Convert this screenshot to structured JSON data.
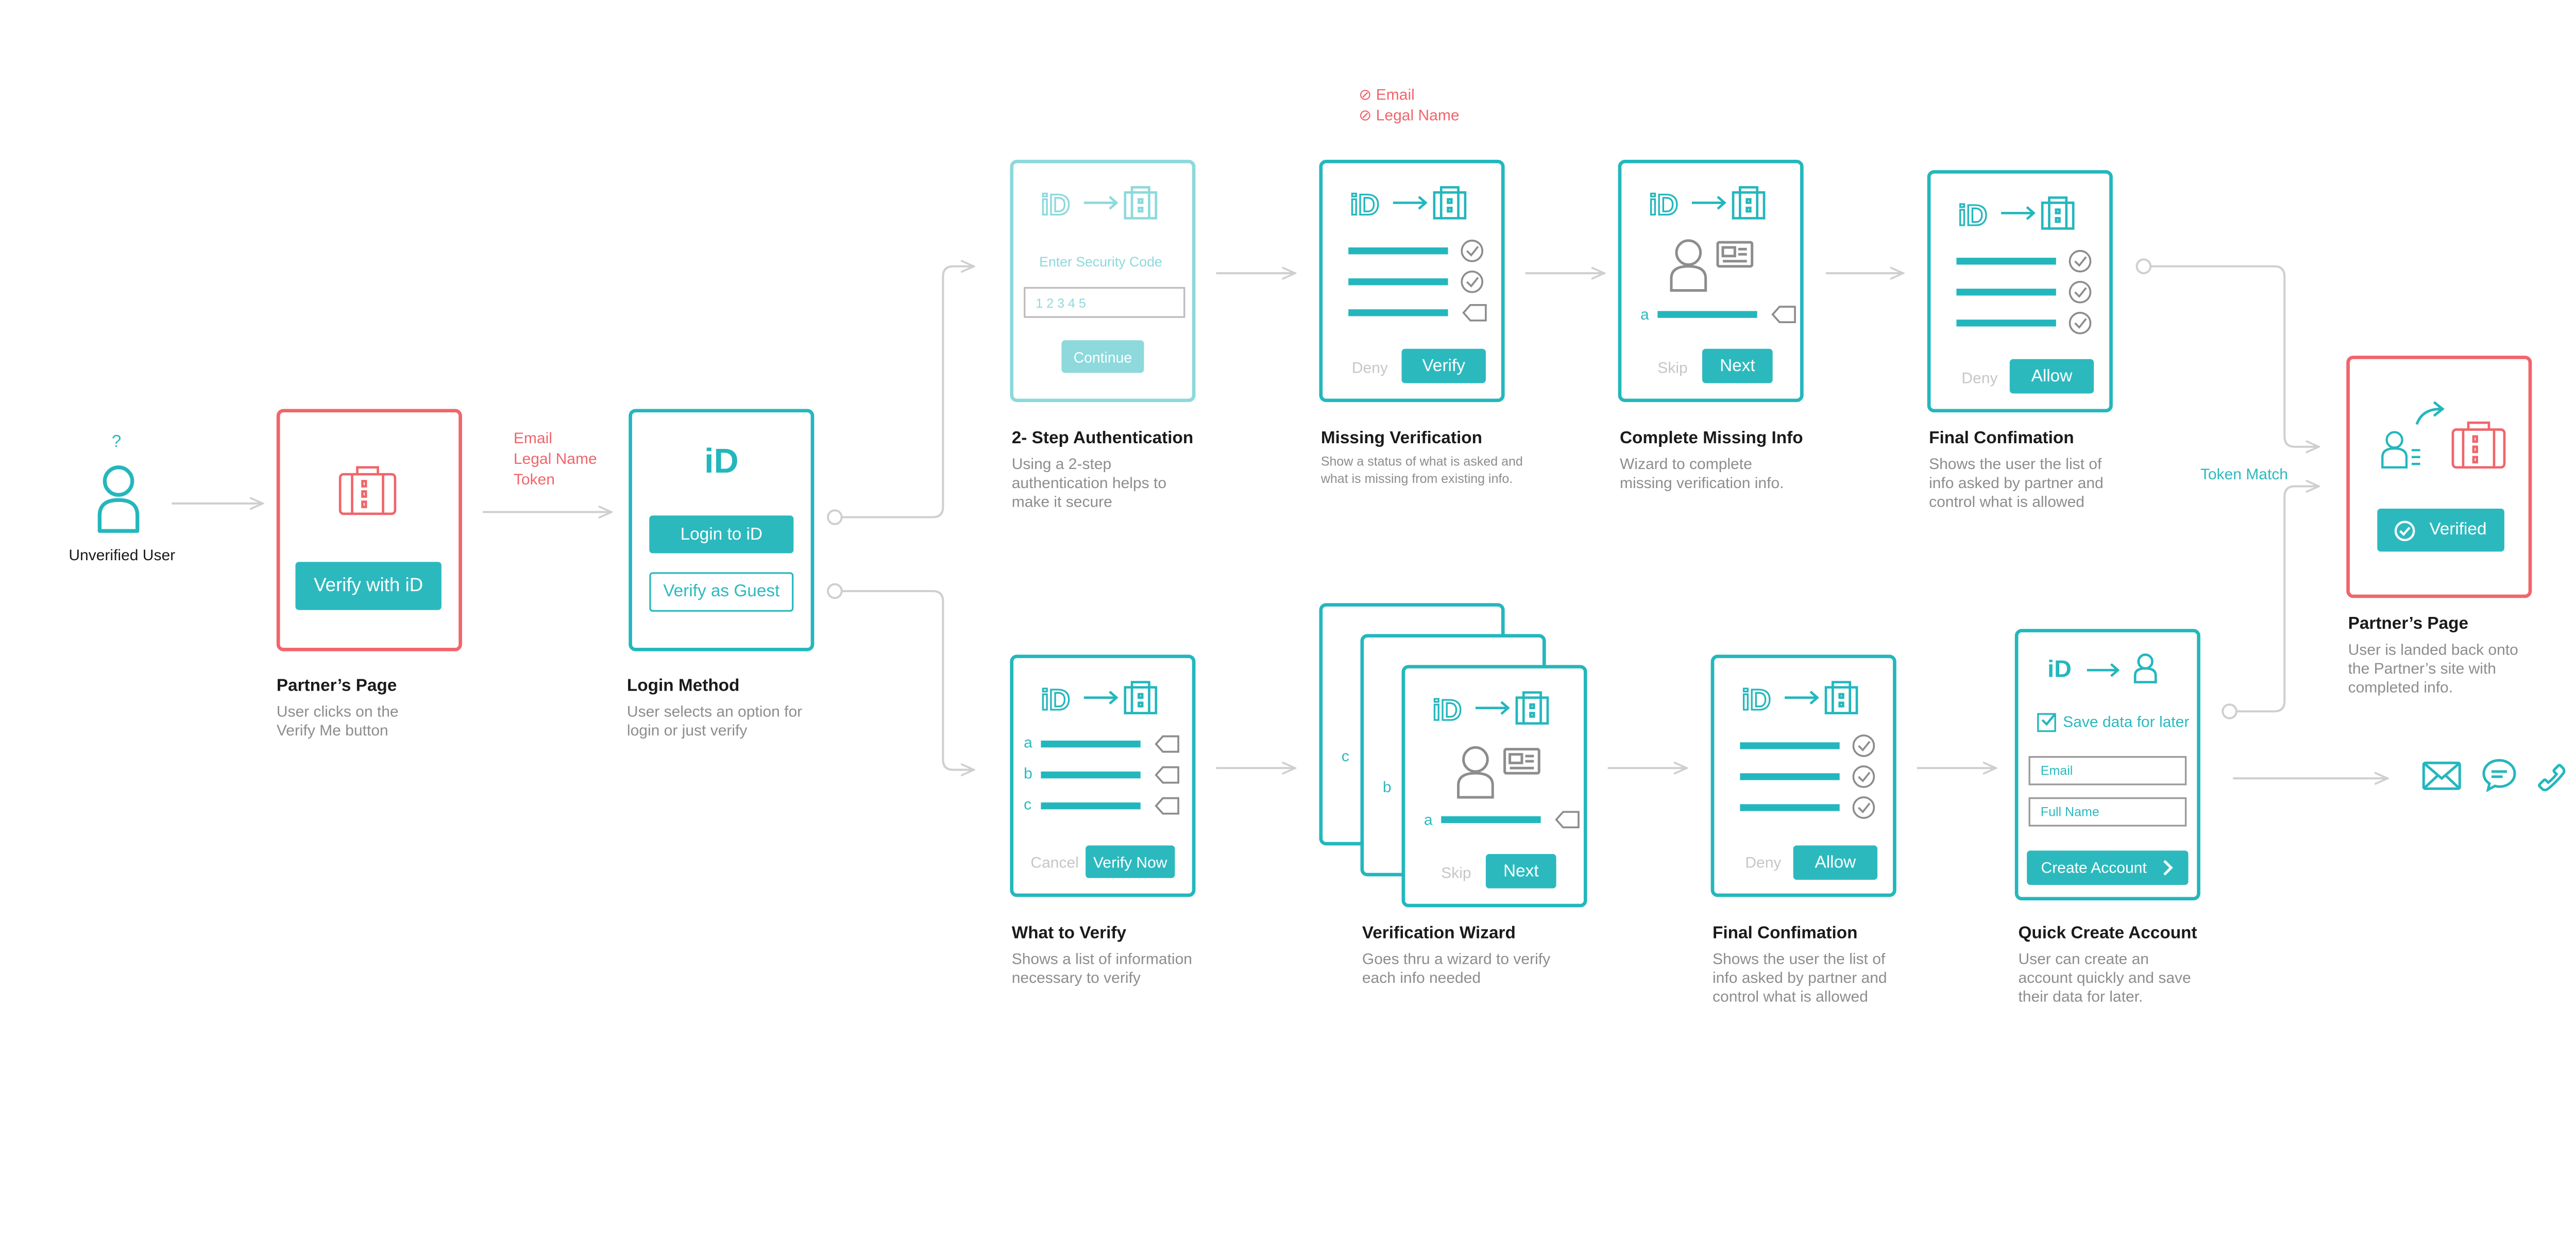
{
  "colors": {
    "teal": "#23b7bd",
    "red": "#f0656b",
    "line": "#cfcfcf",
    "gray": "#8d8d8d"
  },
  "start": {
    "question_mark": "?",
    "label": "Unverified User"
  },
  "partner_page": {
    "button": "Verify with iD",
    "title": "Partner’s Page",
    "desc": [
      "User clicks on the",
      "Verify Me button"
    ],
    "data_fields": [
      "Email",
      "Legal Name",
      "Token"
    ]
  },
  "login_method": {
    "login_button": "Login to iD",
    "guest_button": "Verify as Guest",
    "title": "Login Method",
    "desc": [
      "User selects an option for",
      "login or just verify"
    ]
  },
  "two_step": {
    "prompt": "Enter Security Code",
    "code": "1 2 3 4 5",
    "continue": "Continue",
    "title": "2- Step Authentication",
    "desc": [
      "Using a 2-step",
      "authentication helps to",
      "make it secure"
    ]
  },
  "missing_verification": {
    "notes": [
      "Email",
      "Legal Name"
    ],
    "deny": "Deny",
    "verify": "Verify",
    "title": "Missing Verification",
    "desc": [
      "Show a status of what is asked and",
      "what is missing from existing info."
    ]
  },
  "complete_missing": {
    "field_letter": "a",
    "skip": "Skip",
    "next": "Next",
    "title": "Complete Missing Info",
    "desc": [
      "Wizard to complete",
      "missing verification info."
    ]
  },
  "final_top": {
    "deny": "Deny",
    "allow": "Allow",
    "title": "Final Confimation",
    "desc": [
      "Shows the user the list of",
      "info asked by partner and",
      "control what is allowed"
    ]
  },
  "token_match": "Token Match",
  "partner_final": {
    "verified": "Verified",
    "title": "Partner’s Page",
    "desc": [
      "User is landed back onto",
      "the Partner’s site with",
      "completed info."
    ]
  },
  "what_to_verify": {
    "letters": [
      "a",
      "b",
      "c"
    ],
    "cancel": "Cancel",
    "verify_now": "Verify Now",
    "title": "What to Verify",
    "desc": [
      "Shows a list of information",
      "necessary to verify"
    ]
  },
  "wizard": {
    "back_letters": [
      "c",
      "b"
    ],
    "field_letter": "a",
    "skip": "Skip",
    "next": "Next",
    "title": "Verification Wizard",
    "desc": [
      "Goes thru a wizard to verify",
      "each info needed"
    ]
  },
  "final_bottom": {
    "deny": "Deny",
    "allow": "Allow",
    "title": "Final Confimation",
    "desc": [
      "Shows the user the list of",
      "info asked by partner and",
      "control what is allowed"
    ]
  },
  "quick_create": {
    "save_label": "Save data for later",
    "email_placeholder": "Email",
    "name_placeholder": "Full Name",
    "create": "Create Account",
    "title": "Quick Create Account",
    "desc": [
      "User can create an",
      "account quickly and save",
      "their data for later."
    ]
  },
  "contact_icons": [
    "mail-icon",
    "chat-icon",
    "phone-icon"
  ]
}
